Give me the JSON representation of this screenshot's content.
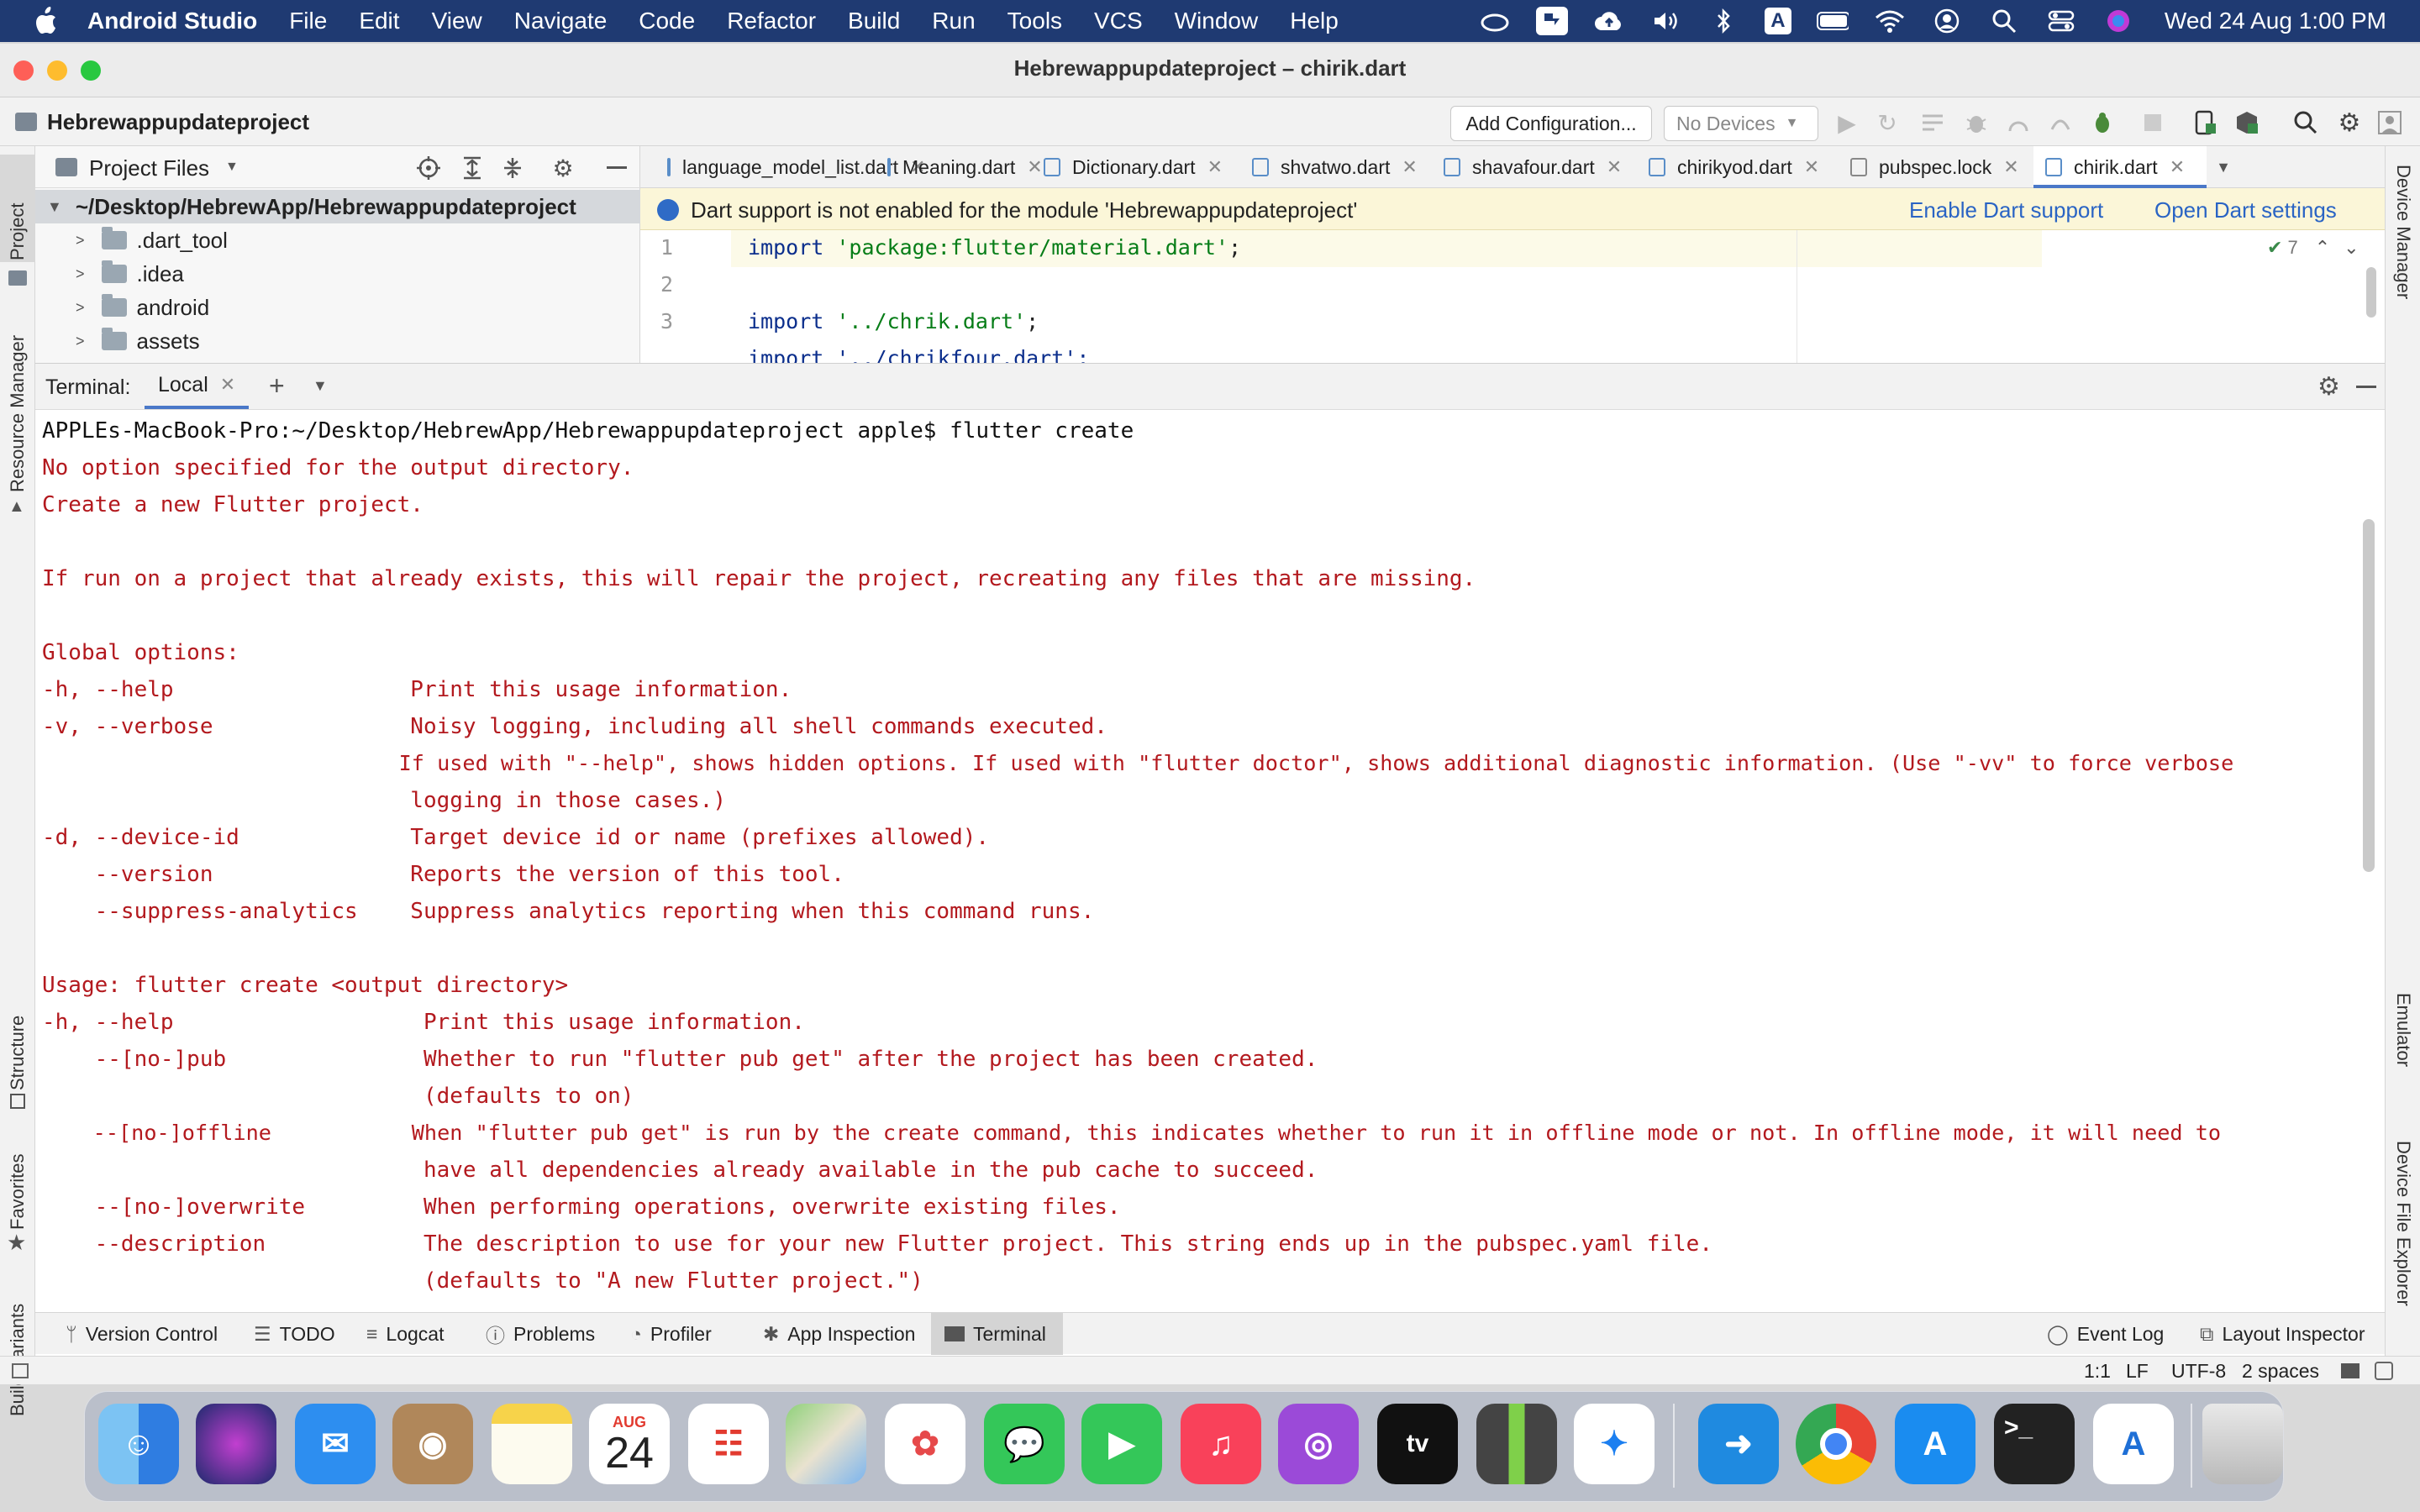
{
  "menubar": {
    "app_name": "Android Studio",
    "items": [
      "File",
      "Edit",
      "View",
      "Navigate",
      "Code",
      "Refactor",
      "Build",
      "Run",
      "Tools",
      "VCS",
      "Window",
      "Help"
    ],
    "clock": "Wed 24 Aug  1:00 PM",
    "input_source": "A"
  },
  "window": {
    "title": "Hebrewappupdateproject – chirik.dart"
  },
  "navbar": {
    "project": "Hebrewappupdateproject",
    "add_config": "Add Configuration...",
    "devices": "No Devices"
  },
  "left_strip": {
    "project": "Project",
    "resource_manager": "Resource Manager",
    "structure": "Structure",
    "favorites": "Favorites",
    "build_variants": "Build Variants"
  },
  "right_strip": {
    "device_manager": "Device Manager",
    "emulator": "Emulator",
    "device_file_explorer": "Device File Explorer"
  },
  "project_panel": {
    "title": "Project Files",
    "root": "~/Desktop/HebrewApp/Hebrewappupdateproject",
    "items": [
      ".dart_tool",
      ".idea",
      "android",
      "assets"
    ]
  },
  "editor": {
    "tabs": [
      "language_model_list.dart",
      "Meaning.dart",
      "Dictionary.dart",
      "shvatwo.dart",
      "shavafour.dart",
      "chirikyod.dart",
      "pubspec.lock",
      "chirik.dart"
    ],
    "banner": {
      "message": "Dart support is not enabled for the module 'Hebrewappupdateproject'",
      "enable": "Enable Dart support",
      "settings": "Open Dart settings"
    },
    "inspection_count": "7",
    "line_numbers": [
      "1",
      "2",
      "3"
    ],
    "lines": {
      "l1_kw": "import ",
      "l1_str": "'package:flutter/material.dart'",
      "l3_kw": "import ",
      "l3_str": "'../chrik.dart'",
      "l4_partial": "import '../chrikfour.dart';",
      "semicolon": ";"
    }
  },
  "terminal": {
    "label": "Terminal:",
    "tab": "Local",
    "lines": [
      "APPLEs-MacBook-Pro:~/Desktop/HebrewApp/Hebrewappupdateproject apple$ flutter create",
      "No option specified for the output directory.",
      "Create a new Flutter project.",
      "",
      "If run on a project that already exists, this will repair the project, recreating any files that are missing.",
      "",
      "Global options:",
      "-h, --help                  Print this usage information.",
      "-v, --verbose               Noisy logging, including all shell commands executed.",
      "                            If used with \"--help\", shows hidden options. If used with \"flutter doctor\", shows additional diagnostic information. (Use \"-vv\" to force verbose",
      "                            logging in those cases.)",
      "-d, --device-id             Target device id or name (prefixes allowed).",
      "    --version               Reports the version of this tool.",
      "    --suppress-analytics    Suppress analytics reporting when this command runs.",
      "",
      "Usage: flutter create <output directory>",
      "-h, --help                   Print this usage information.",
      "    --[no-]pub               Whether to run \"flutter pub get\" after the project has been created.",
      "                             (defaults to on)",
      "    --[no-]offline           When \"flutter pub get\" is run by the create command, this indicates whether to run it in offline mode or not. In offline mode, it will need to",
      "                             have all dependencies already available in the pub cache to succeed.",
      "    --[no-]overwrite         When performing operations, overwrite existing files.",
      "    --description            The description to use for your new Flutter project. This string ends up in the pubspec.yaml file.",
      "                             (defaults to \"A new Flutter project.\")"
    ]
  },
  "bottom_tools": {
    "left": [
      "Version Control",
      "TODO",
      "Logcat",
      "Problems",
      "Profiler",
      "App Inspection",
      "Terminal"
    ],
    "right": [
      "Event Log",
      "Layout Inspector"
    ]
  },
  "status": {
    "position": "1:1",
    "line_sep": "LF",
    "encoding": "UTF-8",
    "indent": "2 spaces"
  },
  "dock": {
    "calendar_month": "AUG",
    "calendar_day": "24",
    "apps": [
      "Finder",
      "Siri",
      "Mail",
      "Contacts",
      "Notes",
      "Calendar",
      "Reminders",
      "Maps",
      "Photos",
      "Messages",
      "FaceTime",
      "Music",
      "Podcasts",
      "TV",
      "Archive Utility",
      "Safari",
      "Migration",
      "Chrome",
      "App Store",
      "Terminal",
      "Android Studio",
      "Trash"
    ]
  },
  "colors": {
    "menubar": "#1f3a72",
    "terminal_text": "#b3191e",
    "accent": "#4a78c8",
    "banner": "#fbf6d8"
  }
}
